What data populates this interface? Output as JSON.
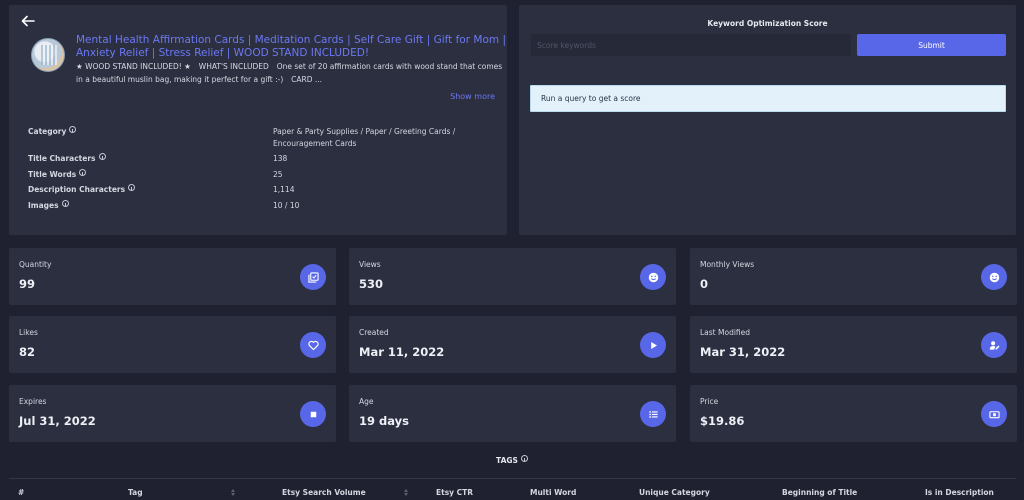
{
  "listing": {
    "title": "Mental Health Affirmation Cards | Meditation Cards | Self Care Gift | Gift for Mom | Anxiety Relief | Stress Relief | WOOD STAND INCLUDED!",
    "description": "★ WOOD STAND INCLUDED! ★ ⠀WHAT'S INCLUDED⠀ One set of 20 affirmation cards with wood stand that comes in a beautiful muslin bag, making it perfect for a gift :-) ⠀CARD ...",
    "show_more": "Show more",
    "attributes": [
      {
        "label": "Category",
        "value": "Paper & Party Supplies / Paper / Greeting Cards / Encouragement Cards"
      },
      {
        "label": "Title Characters",
        "value": "138"
      },
      {
        "label": "Title Words",
        "value": "25"
      },
      {
        "label": "Description Characters",
        "value": "1,114"
      },
      {
        "label": "Images",
        "value": "10 / 10"
      }
    ]
  },
  "keyword": {
    "title": "Keyword Optimization Score",
    "placeholder": "Score keywords",
    "submit_label": "Submit",
    "result_text": "Run a query to get a score"
  },
  "stats": [
    {
      "label": "Quantity",
      "value": "99",
      "icon": "checklist-icon"
    },
    {
      "label": "Views",
      "value": "530",
      "icon": "smiley-icon"
    },
    {
      "label": "Monthly Views",
      "value": "0",
      "icon": "smiley-icon"
    },
    {
      "label": "Likes",
      "value": "82",
      "icon": "heart-icon"
    },
    {
      "label": "Created",
      "value": "Mar 11, 2022",
      "icon": "play-icon"
    },
    {
      "label": "Last Modified",
      "value": "Mar 31, 2022",
      "icon": "user-edit-icon"
    },
    {
      "label": "Expires",
      "value": "Jul 31, 2022",
      "icon": "stop-icon"
    },
    {
      "label": "Age",
      "value": "19 days",
      "icon": "list-icon"
    },
    {
      "label": "Price",
      "value": "$19.86",
      "icon": "money-icon"
    }
  ],
  "tags": {
    "title": "TAGS",
    "columns": [
      "#",
      "Tag",
      "Etsy Search Volume",
      "Etsy CTR",
      "Multi Word",
      "Unique Category",
      "Beginning of Title",
      "Is in Description"
    ]
  },
  "colors": {
    "background": "#1f2130",
    "panel": "#2c2f40",
    "accent": "#5867e8",
    "link": "#6b78f3",
    "result_bg": "#e3f1fb"
  }
}
